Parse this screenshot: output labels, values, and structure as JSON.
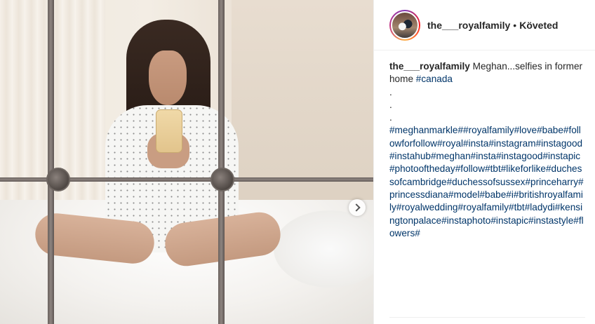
{
  "post": {
    "username": "the___royalfamily",
    "separator": "•",
    "follow_state": "Követed"
  },
  "caption": {
    "username": "the___royalfamily",
    "text": "Meghan...selfies in former home",
    "first_tag": "#canada",
    "dots": [
      ".",
      ".",
      "."
    ],
    "tags": [
      "#meghanmarkle",
      "#",
      "#royalfamily",
      "#love",
      "#babe",
      "#followforfollow",
      "#royal",
      "#insta",
      "#instagram",
      "#instagood",
      "#instahub",
      "#meghan",
      "#insta",
      "#instagood",
      "#instapic",
      "#photooftheday",
      "#follow",
      "#tbt",
      "#likeforlike",
      "#duchessofcambridge",
      "#duchessofsussex",
      "#princeharry",
      "#princessdiana",
      "#model",
      "#babe",
      "#i",
      "#britishroyalfamily",
      "#royalwedding",
      "#royalfamily",
      "#tbt",
      "#ladydi",
      "#kensingtonpalace",
      "#instaphoto",
      "#instapic",
      "#instastyle",
      "#flowers",
      "#"
    ]
  },
  "colors": {
    "hashtag": "#003569",
    "text": "#262626",
    "border": "#efefef"
  },
  "icons": {
    "next": "chevron-right-icon"
  }
}
